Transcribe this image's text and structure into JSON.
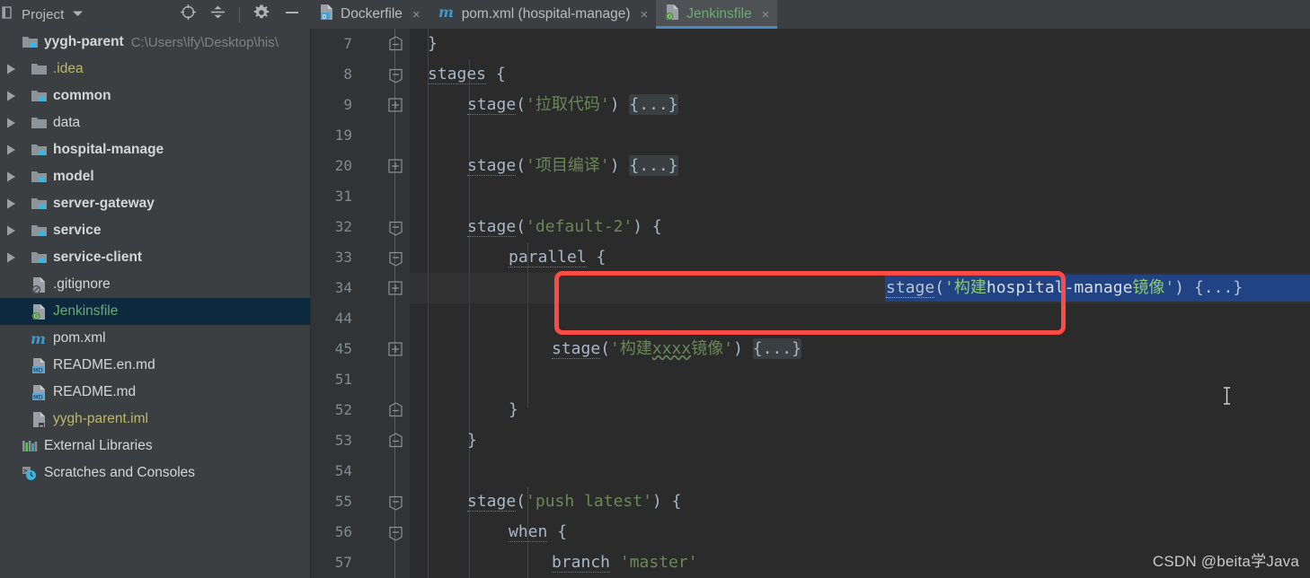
{
  "toolwindow": {
    "title": "Project",
    "caret_icon": "chevron-down-icon",
    "icons": [
      {
        "name": "locate-target-icon",
        "label": "Select Opened File"
      },
      {
        "name": "collapse-all-icon",
        "label": "Collapse All"
      },
      {
        "name": "settings-gear-icon",
        "label": "Settings"
      },
      {
        "name": "minimize-icon",
        "label": "Hide"
      }
    ]
  },
  "tabs": [
    {
      "label": "Dockerfile",
      "icon": "docker-file-icon",
      "active": false,
      "close_glyph": "×"
    },
    {
      "label": "pom.xml (hospital-manage)",
      "icon": "maven-file-icon",
      "active": false,
      "close_glyph": "×"
    },
    {
      "label": "Jenkinsfile",
      "icon": "groovy-file-icon",
      "active": true,
      "close_glyph": "×"
    }
  ],
  "tree": [
    {
      "label": "yygh-parent",
      "sub": "C:\\Users\\lfy\\Desktop\\his\\",
      "icon": "module-folder-icon",
      "arrow": "expanded",
      "depth": 0,
      "bold": true,
      "selected": false
    },
    {
      "label": ".idea",
      "sub": "",
      "icon": "folder-icon",
      "arrow": "collapsed",
      "depth": 1,
      "bold": false,
      "yellow": true,
      "selected": false
    },
    {
      "label": "common",
      "sub": "",
      "icon": "module-folder-icon",
      "arrow": "collapsed",
      "depth": 1,
      "bold": true,
      "selected": false
    },
    {
      "label": "data",
      "sub": "",
      "icon": "folder-icon",
      "arrow": "collapsed",
      "depth": 1,
      "bold": false,
      "selected": false
    },
    {
      "label": "hospital-manage",
      "sub": "",
      "icon": "module-folder-icon",
      "arrow": "collapsed",
      "depth": 1,
      "bold": true,
      "selected": false
    },
    {
      "label": "model",
      "sub": "",
      "icon": "module-folder-icon",
      "arrow": "collapsed",
      "depth": 1,
      "bold": true,
      "selected": false
    },
    {
      "label": "server-gateway",
      "sub": "",
      "icon": "module-folder-icon",
      "arrow": "collapsed",
      "depth": 1,
      "bold": true,
      "selected": false
    },
    {
      "label": "service",
      "sub": "",
      "icon": "module-folder-icon",
      "arrow": "collapsed",
      "depth": 1,
      "bold": true,
      "selected": false
    },
    {
      "label": "service-client",
      "sub": "",
      "icon": "module-folder-icon",
      "arrow": "collapsed",
      "depth": 1,
      "bold": true,
      "selected": false
    },
    {
      "label": ".gitignore",
      "sub": "",
      "icon": "gitignore-file-icon",
      "arrow": "none",
      "depth": 1,
      "bold": false,
      "selected": false
    },
    {
      "label": "Jenkinsfile",
      "sub": "",
      "icon": "groovy-file-icon",
      "arrow": "none",
      "depth": 1,
      "bold": false,
      "selected": true
    },
    {
      "label": "pom.xml",
      "sub": "",
      "icon": "maven-file-icon",
      "arrow": "none",
      "depth": 1,
      "bold": false,
      "selected": false
    },
    {
      "label": "README.en.md",
      "sub": "",
      "icon": "markdown-file-icon",
      "arrow": "none",
      "depth": 1,
      "bold": false,
      "selected": false
    },
    {
      "label": "README.md",
      "sub": "",
      "icon": "markdown-file-icon",
      "arrow": "none",
      "depth": 1,
      "bold": false,
      "selected": false
    },
    {
      "label": "yygh-parent.iml",
      "sub": "",
      "icon": "iml-file-icon",
      "arrow": "none",
      "depth": 1,
      "bold": false,
      "yellow": true,
      "selected": false
    },
    {
      "label": "External Libraries",
      "sub": "",
      "icon": "external-libraries-icon",
      "arrow": "none",
      "depth": 0,
      "bold": false,
      "selected": false
    },
    {
      "label": "Scratches and Consoles",
      "sub": "",
      "icon": "scratches-icon",
      "arrow": "none",
      "depth": 0,
      "bold": false,
      "selected": false
    }
  ],
  "editor": {
    "filename": "Jenkinsfile",
    "line_numbers": [
      "7",
      "8",
      "9",
      "19",
      "20",
      "31",
      "32",
      "33",
      "34",
      "44",
      "45",
      "51",
      "52",
      "53",
      "54",
      "55",
      "56",
      "57"
    ],
    "fold_markers": [
      "minus-up",
      "minus-down",
      "plus",
      "none",
      "plus",
      "none",
      "minus-down",
      "minus-down",
      "plus",
      "none",
      "plus",
      "none",
      "minus-up",
      "minus-up",
      "none",
      "minus-down",
      "minus-down",
      "none"
    ],
    "lines": [
      {
        "indent": 4,
        "text": "}",
        "folded": ""
      },
      {
        "indent": 4,
        "text": "stages {",
        "folded": "",
        "method": "stages"
      },
      {
        "indent": 8,
        "text": "stage('拉取代码') ",
        "folded": "{...}",
        "method": "stage",
        "str": "'拉取代码'"
      },
      {
        "indent": 0,
        "text": "",
        "folded": ""
      },
      {
        "indent": 8,
        "text": "stage('项目编译') ",
        "folded": "{...}",
        "method": "stage",
        "str": "'项目编译'"
      },
      {
        "indent": 0,
        "text": "",
        "folded": ""
      },
      {
        "indent": 8,
        "text": "stage('default-2') {",
        "folded": "",
        "method": "stage",
        "str": "'default-2'"
      },
      {
        "indent": 12,
        "text": "parallel {",
        "folded": "",
        "method": "parallel"
      },
      {
        "indent": 16,
        "text": "stage('构建hospital-manage镜像') {...}",
        "folded": "",
        "selected": true
      },
      {
        "indent": 0,
        "text": "",
        "folded": ""
      },
      {
        "indent": 16,
        "text": "stage('构建xxxx镜像') ",
        "folded": "{...}",
        "method": "stage",
        "str": "'构建xxxx镜像'"
      },
      {
        "indent": 0,
        "text": "",
        "folded": ""
      },
      {
        "indent": 12,
        "text": "}",
        "folded": ""
      },
      {
        "indent": 8,
        "text": "}",
        "folded": ""
      },
      {
        "indent": 0,
        "text": "",
        "folded": ""
      },
      {
        "indent": 8,
        "text": "stage('push latest') {",
        "folded": "",
        "method": "stage",
        "str": "'push latest'"
      },
      {
        "indent": 12,
        "text": "when {",
        "folded": "",
        "method": "when"
      },
      {
        "indent": 16,
        "text": "branch 'master'",
        "folded": "",
        "method": "branch",
        "str": "'master'"
      }
    ],
    "selected_line_text": "stage('构建hospital-manage镜像') {...}",
    "cursor_icon": "text-ibeam-cursor"
  },
  "annotation": {
    "shape": "red-rectangle",
    "color": "#fc4b45"
  },
  "watermark": {
    "text": "CSDN @beita学Java"
  },
  "colors": {
    "accent_blue": "#4a88c7",
    "selection_blue": "#214283",
    "string_green": "#6a8759",
    "active_tab_green": "#6aab73",
    "editor_bg": "#2b2b2b",
    "panel_bg": "#3c3f41",
    "gutter_bg": "#313335",
    "selected_row_bg": "#0d293e",
    "annotation_red": "#fc4b45"
  }
}
